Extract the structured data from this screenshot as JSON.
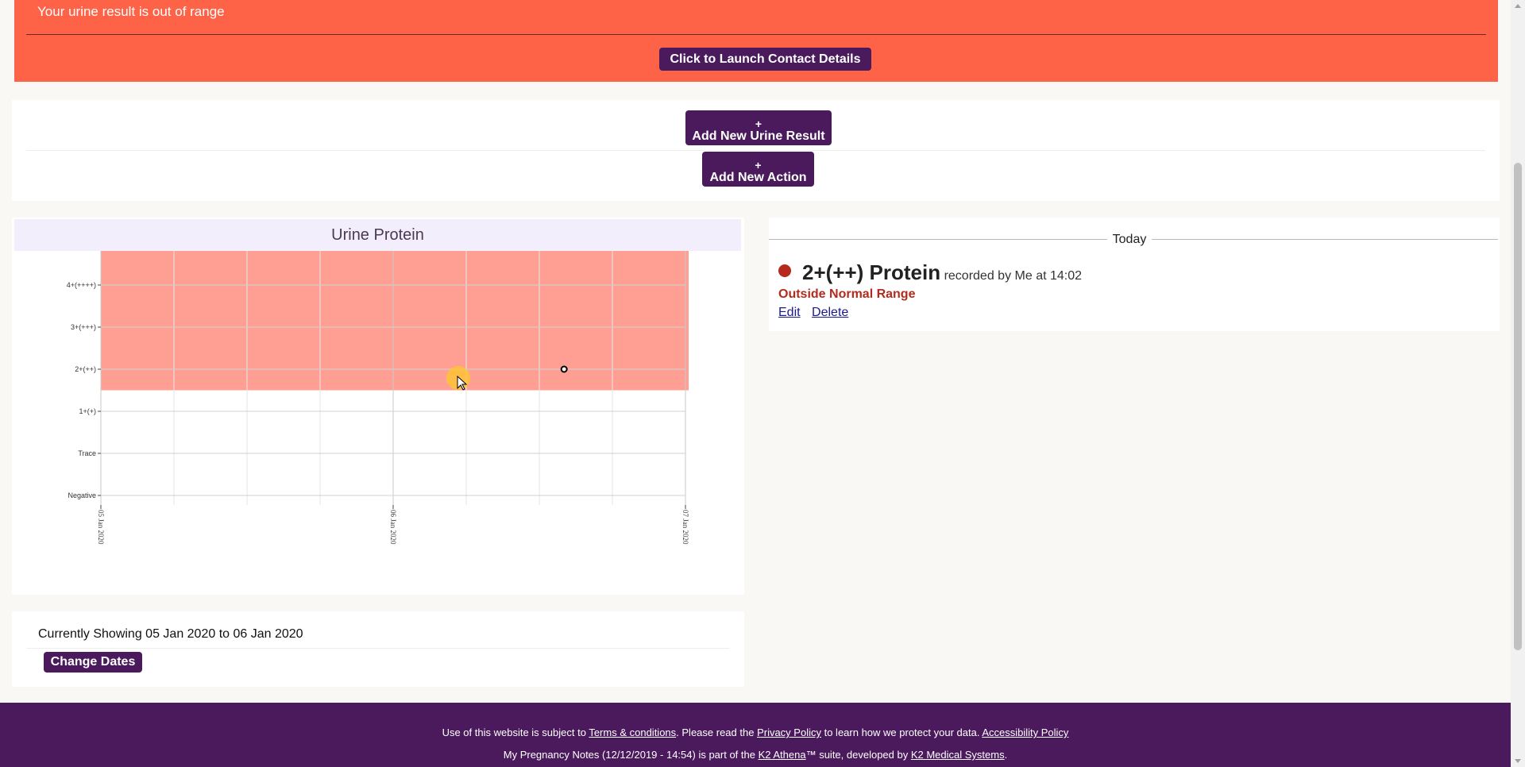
{
  "alert": {
    "message": "Your urine result is out of range",
    "contact_button": "Click to Launch Contact Details"
  },
  "actions": {
    "plus": "+",
    "add_urine_result": "Add New Urine Result",
    "add_action": "Add New Action"
  },
  "chart_panel": {
    "title": "Urine Protein"
  },
  "chart_data": {
    "type": "scatter",
    "title": "Urine Protein",
    "y_categories": [
      "Negative",
      "Trace",
      "1+(+)",
      "2+(++)",
      "3+(+++)",
      "4+(++++)"
    ],
    "x_tick_labels": [
      "05 Jan 2020",
      "06 Jan 2020",
      "07 Jan 2020"
    ],
    "x_range": [
      "2020-01-05",
      "2020-01-07"
    ],
    "out_of_range_band": [
      "2+(++)",
      "4+(++++)"
    ],
    "band_color": "#ff9f93",
    "points": [
      {
        "x": "2020-01-06T14:02",
        "y": "2+(++)"
      }
    ],
    "grid": true
  },
  "timeline": {
    "heading": "Today",
    "entries": [
      {
        "value": "2+(++) Protein",
        "meta": "recorded by Me at 14:02",
        "status": "Outside Normal Range",
        "edit_label": "Edit",
        "delete_label": "Delete",
        "status_color": "#b52a1c"
      }
    ]
  },
  "range": {
    "text": "Currently Showing 05 Jan 2020 to 06 Jan 2020",
    "change_button": "Change Dates"
  },
  "footer": {
    "line1_pre": "Use of this website is subject to ",
    "terms_link": "Terms & conditions",
    "line1_mid": ". Please read the ",
    "privacy_link": "Privacy Policy",
    "line1_post": " to learn how we protect your data. ",
    "accessibility_link": "Accessibility Policy",
    "line2_pre": "My Pregnancy Notes (12/12/2019 - 14:54) is part of the ",
    "athena_link": "K2 Athena",
    "line2_mid": "™ suite, developed by ",
    "k2_link": "K2 Medical Systems",
    "line2_post": "."
  },
  "colors": {
    "alert_bg": "#ff6347",
    "brand_purple": "#4a1a5c",
    "status_red": "#b52a1c"
  }
}
